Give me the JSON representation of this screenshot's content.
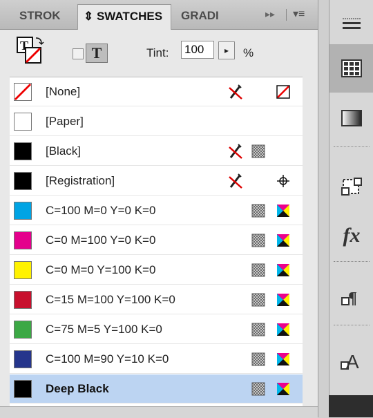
{
  "tabs": [
    {
      "label": "STROK",
      "active": false
    },
    {
      "label": "⇕ SWATCHES",
      "active": true
    },
    {
      "label": "GRADI",
      "active": false
    }
  ],
  "tab_icons": {
    "forward": "▸▸",
    "menu": "▾≡"
  },
  "controls": {
    "tint_label": "Tint:",
    "tint_value": "100",
    "tint_arrow": "▸",
    "tint_unit": "%",
    "text_toggle": "T"
  },
  "swatches": [
    {
      "name": "[None]",
      "color": "#ffffff",
      "noedit": true,
      "icon1": "",
      "icon2": "none-swatch-icon"
    },
    {
      "name": "[Paper]",
      "color": "#ffffff",
      "noedit": false,
      "icon1": "",
      "icon2": ""
    },
    {
      "name": "[Black]",
      "color": "#000000",
      "noedit": true,
      "icon1": "process-icon",
      "icon2": ""
    },
    {
      "name": "[Registration]",
      "color": "#000000",
      "noedit": true,
      "icon1": "",
      "icon2": "registration-icon"
    },
    {
      "name": "C=100 M=0 Y=0 K=0",
      "color": "#00a4e4",
      "noedit": false,
      "icon1": "process-icon",
      "icon2": "cmyk-icon"
    },
    {
      "name": "C=0 M=100 Y=0 K=0",
      "color": "#e4008c",
      "noedit": false,
      "icon1": "process-icon",
      "icon2": "cmyk-icon"
    },
    {
      "name": "C=0 M=0 Y=100 K=0",
      "color": "#fff200",
      "noedit": false,
      "icon1": "process-icon",
      "icon2": "cmyk-icon"
    },
    {
      "name": "C=15 M=100 Y=100 K=0",
      "color": "#c8102e",
      "noedit": false,
      "icon1": "process-icon",
      "icon2": "cmyk-icon"
    },
    {
      "name": "C=75 M=5 Y=100 K=0",
      "color": "#3ca845",
      "noedit": false,
      "icon1": "process-icon",
      "icon2": "cmyk-icon"
    },
    {
      "name": "C=100 M=90 Y=10 K=0",
      "color": "#25358c",
      "noedit": false,
      "icon1": "process-icon",
      "icon2": "cmyk-icon"
    },
    {
      "name": "Deep Black",
      "color": "#000000",
      "noedit": false,
      "icon1": "process-icon",
      "icon2": "cmyk-icon",
      "selected": true
    }
  ],
  "toolstrip": [
    {
      "name": "panel-menu-icon"
    },
    {
      "name": "swatches-panel-icon",
      "active": true
    },
    {
      "name": "gradient-panel-icon"
    },
    {
      "name": "effects-panel-icon"
    },
    {
      "name": "fx-panel-icon",
      "label": "fx"
    },
    {
      "name": "paragraph-styles-icon"
    },
    {
      "name": "character-styles-icon"
    }
  ],
  "colors": {
    "selection": "#bcd4f2",
    "panel": "#e8e8e8",
    "list": "#ffffff"
  }
}
